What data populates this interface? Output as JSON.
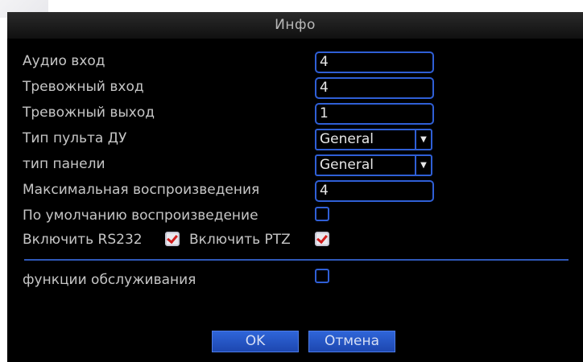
{
  "dialog": {
    "title": "Инфо"
  },
  "fields": {
    "audio_in": {
      "label": "Аудио вход",
      "value": "4"
    },
    "alarm_in": {
      "label": "Тревожный вход",
      "value": "4"
    },
    "alarm_out": {
      "label": "Тревожный выход",
      "value": "1"
    },
    "remote_type": {
      "label": "Тип пульта ДУ",
      "value": "General"
    },
    "panel_type": {
      "label": "тип панели",
      "value": "General"
    },
    "max_playback": {
      "label": "Максимальная воспроизведения",
      "value": "4"
    },
    "default_playback": {
      "label": "По умолчанию воспроизведение",
      "checked": false
    },
    "rs232": {
      "label": "Включить RS232",
      "checked": true
    },
    "ptz": {
      "label": "Включить PTZ",
      "checked": true
    },
    "maintenance": {
      "label": "функции обслуживания",
      "checked": false
    }
  },
  "buttons": {
    "ok": "OK",
    "cancel": "Отмена"
  },
  "colors": {
    "accent": "#2f5fd6",
    "check_mark": "#d21d1d",
    "background": "#000000"
  }
}
